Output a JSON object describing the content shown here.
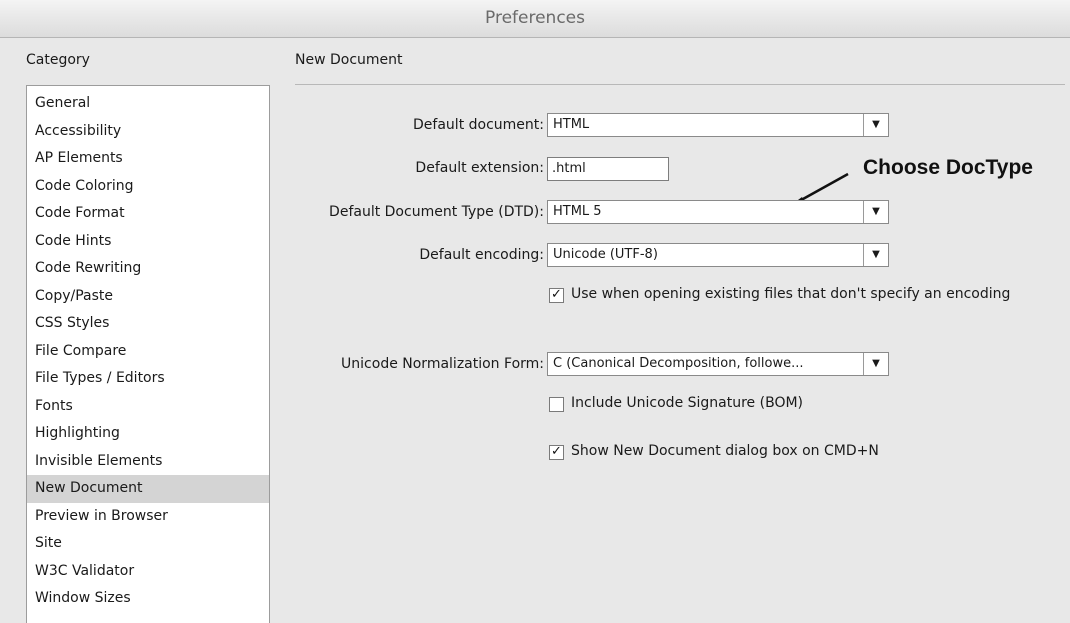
{
  "window": {
    "title": "Preferences"
  },
  "category": {
    "header": "Category",
    "items": [
      "General",
      "Accessibility",
      "AP Elements",
      "Code Coloring",
      "Code Format",
      "Code Hints",
      "Code Rewriting",
      "Copy/Paste",
      "CSS Styles",
      "File Compare",
      "File Types / Editors",
      "Fonts",
      "Highlighting",
      "Invisible Elements",
      "New Document",
      "Preview in Browser",
      "Site",
      "W3C Validator",
      "Window Sizes"
    ],
    "selected": "New Document"
  },
  "panel": {
    "title": "New Document",
    "default_document_label": "Default document:",
    "default_document_value": "HTML",
    "default_extension_label": "Default extension:",
    "default_extension_value": ".html",
    "doctype_label": "Default Document Type (DTD):",
    "doctype_value": "HTML 5",
    "encoding_label": "Default encoding:",
    "encoding_value": "Unicode (UTF-8)",
    "use_when_opening_label": "Use when opening existing files that don't specify an encoding",
    "use_when_opening_checked": true,
    "normalization_label": "Unicode Normalization Form:",
    "normalization_value": "C (Canonical Decomposition, followe...",
    "include_bom_label": "Include Unicode Signature (BOM)",
    "include_bom_checked": false,
    "show_dialog_label": "Show New Document dialog box on CMD+N",
    "show_dialog_checked": true
  },
  "annotation": {
    "text": "Choose DocType"
  },
  "glyphs": {
    "dropdown_arrow": "▼",
    "checkmark": "✓"
  }
}
